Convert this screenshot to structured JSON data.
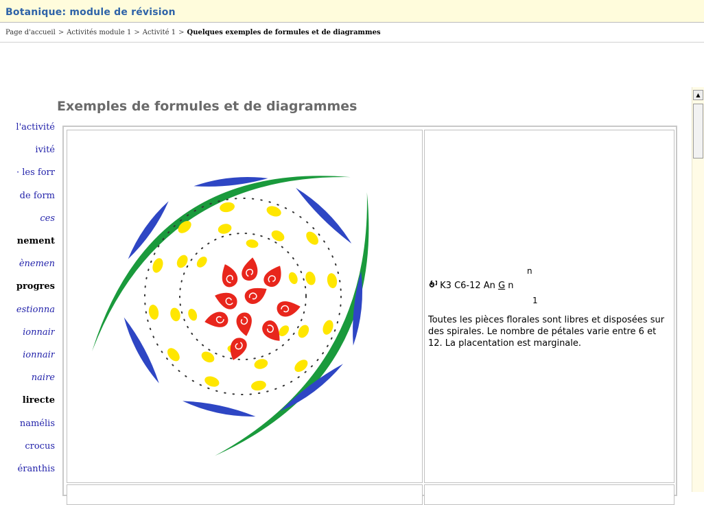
{
  "header": {
    "site_title": "Botanique: module de révision"
  },
  "breadcrumb": {
    "items": [
      "Page d'accueil",
      "Activités module 1",
      "Activité 1"
    ],
    "current": "Quelques exemples de formules et de diagrammes",
    "separator": ">"
  },
  "page": {
    "heading": "Exemples de formules et de diagrammes"
  },
  "leftnav": {
    "items": [
      {
        "label": "l'activité",
        "style": "link"
      },
      {
        "label": "ivité",
        "style": "link"
      },
      {
        "label": "· les forr",
        "style": "link"
      },
      {
        "label": "de form",
        "style": "link"
      },
      {
        "label": "ces",
        "style": "link-italic"
      },
      {
        "label": "nement",
        "style": "head"
      },
      {
        "label": "ènemen",
        "style": "link-italic"
      },
      {
        "label": "progres",
        "style": "head"
      },
      {
        "label": "estionna",
        "style": "link-italic"
      },
      {
        "label": "ionnair",
        "style": "link-italic"
      },
      {
        "label": "ionnair",
        "style": "link-italic"
      },
      {
        "label": "naire",
        "style": "link-italic"
      },
      {
        "label": "lirecte",
        "style": "head"
      },
      {
        "label": "namélis",
        "style": "link"
      },
      {
        "label": "crocus",
        "style": "link"
      },
      {
        "label": "éranthis",
        "style": "link"
      }
    ]
  },
  "formula": {
    "main_prefix": "K3 C6-12 An",
    "gynoecium": "G",
    "ovule": "n",
    "superscript": "n",
    "subscript": "1",
    "description": "Toutes les pièces florales sont libres et disposées sur des spirales. Le nombre de pétales varie entre 6 et 12. La placentation est marginale."
  },
  "diagram": {
    "colors": {
      "bract": "#1a9a3c",
      "sepal": "#2e46c4",
      "stamen": "#ffe600",
      "carpel": "#e8261c",
      "spiral": "#333333"
    }
  },
  "scrollbar": {
    "up_icon": "▲"
  }
}
